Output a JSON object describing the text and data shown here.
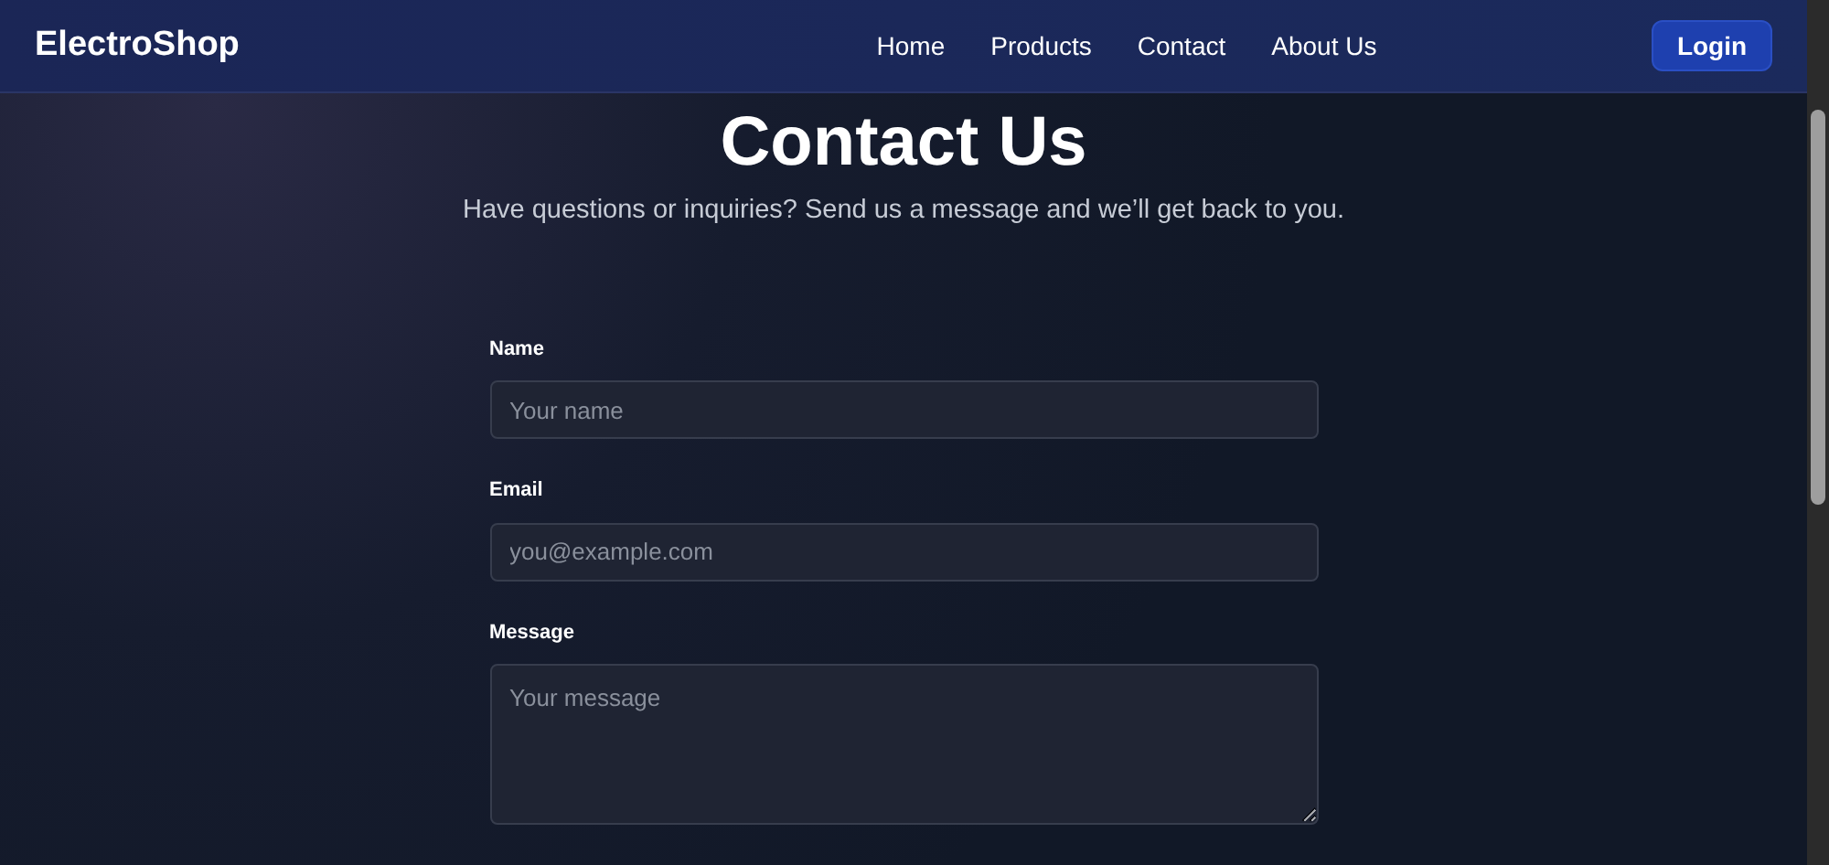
{
  "brand": "ElectroShop",
  "nav": [
    {
      "label": "Home"
    },
    {
      "label": "Products"
    },
    {
      "label": "Contact"
    },
    {
      "label": "About Us"
    }
  ],
  "login": "Login",
  "title": "Contact Us",
  "subtitle": "Have questions or inquiries? Send us a message and we’ll get back to you.",
  "fields": [
    {
      "kind": "input",
      "label": "Name",
      "placeholder": "Your name"
    },
    {
      "kind": "input",
      "label": "Email",
      "placeholder": "you@example.com"
    },
    {
      "kind": "textarea",
      "label": "Message",
      "placeholder": "Your message"
    }
  ]
}
